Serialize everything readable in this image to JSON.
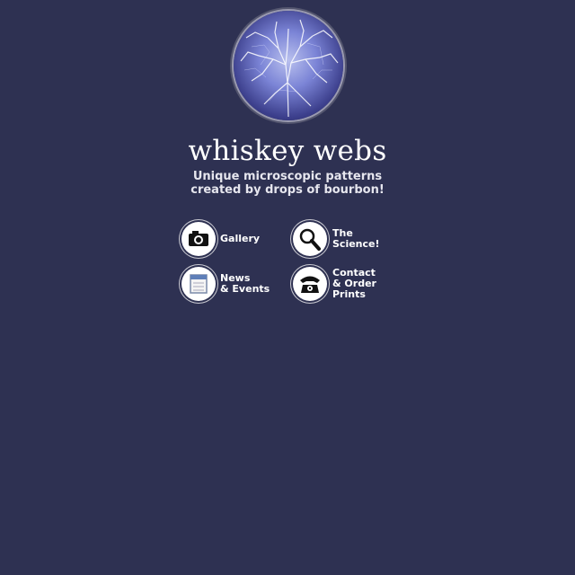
{
  "site": {
    "title": "whiskey webs",
    "tagline_line1": "Unique microscopic patterns",
    "tagline_line2": "created by drops of bourbon!"
  },
  "nav": {
    "gallery": {
      "lines": [
        "Gallery"
      ],
      "icon": "camera-icon"
    },
    "science": {
      "lines": [
        "The",
        "Science!"
      ],
      "icon": "magnifying-glass-icon"
    },
    "news": {
      "lines": [
        "News",
        "& Events"
      ],
      "icon": "calendar-icon"
    },
    "contact": {
      "lines": [
        "Contact",
        "& Order",
        "Prints"
      ],
      "icon": "telephone-icon"
    }
  },
  "colors": {
    "background": "#2e3152",
    "text": "#ffffff"
  }
}
